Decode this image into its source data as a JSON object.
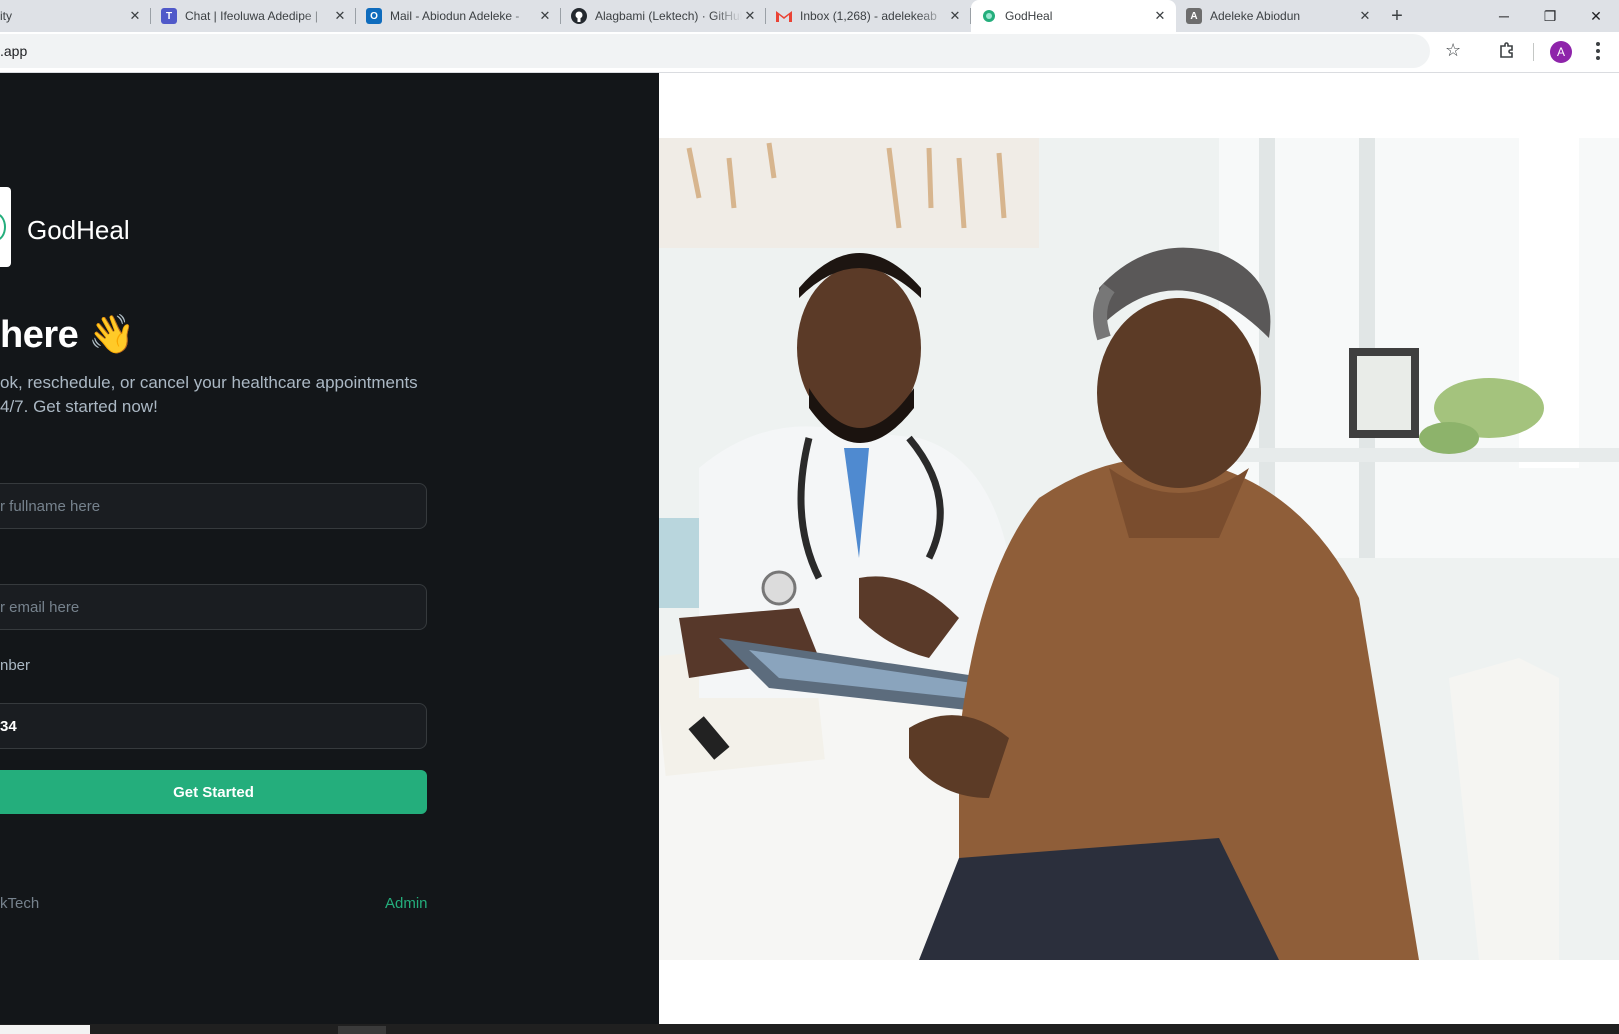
{
  "browser": {
    "tabs": [
      {
        "title": "ity",
        "favicon": "generic-icon",
        "active": false
      },
      {
        "title": "Chat | Ifeoluwa Adedipe |",
        "favicon": "teams-icon",
        "active": false
      },
      {
        "title": "Mail - Abiodun Adeleke -",
        "favicon": "outlook-icon",
        "active": false
      },
      {
        "title": "Alagbami (Lektech) · GitHub",
        "favicon": "github-icon",
        "active": false
      },
      {
        "title": "Inbox (1,268) - adelekeab",
        "favicon": "gmail-icon",
        "active": false
      },
      {
        "title": "GodHeal",
        "favicon": "godheal-icon",
        "active": true
      },
      {
        "title": "Adeleke Abiodun",
        "favicon": "profile-icon",
        "active": false
      }
    ],
    "new_tab": "+",
    "close_glyph": "✕",
    "url": ".app",
    "profile_initial": "A",
    "window_controls": {
      "minimize": "─",
      "restore": "❐",
      "close": "✕"
    }
  },
  "page": {
    "brand": "GodHeal",
    "headline": "here 👋",
    "subtitle": "ok, reschedule, or cancel your healthcare appointments 4/7. Get started now!",
    "form": {
      "name_placeholder": "r fullname here",
      "email_placeholder": "r email here",
      "phone_label": "nber",
      "phone_value": "34",
      "submit_label": "Get Started"
    },
    "footer": {
      "left_text": "kTech",
      "admin_link": "Admin"
    },
    "hero_image": "doctor-and-patient-photo"
  },
  "colors": {
    "page_bg": "#131619",
    "accent": "#24ae7c",
    "input_bg": "#1a1d21",
    "input_border": "#363a3d",
    "text_muted": "#abb8c4"
  }
}
